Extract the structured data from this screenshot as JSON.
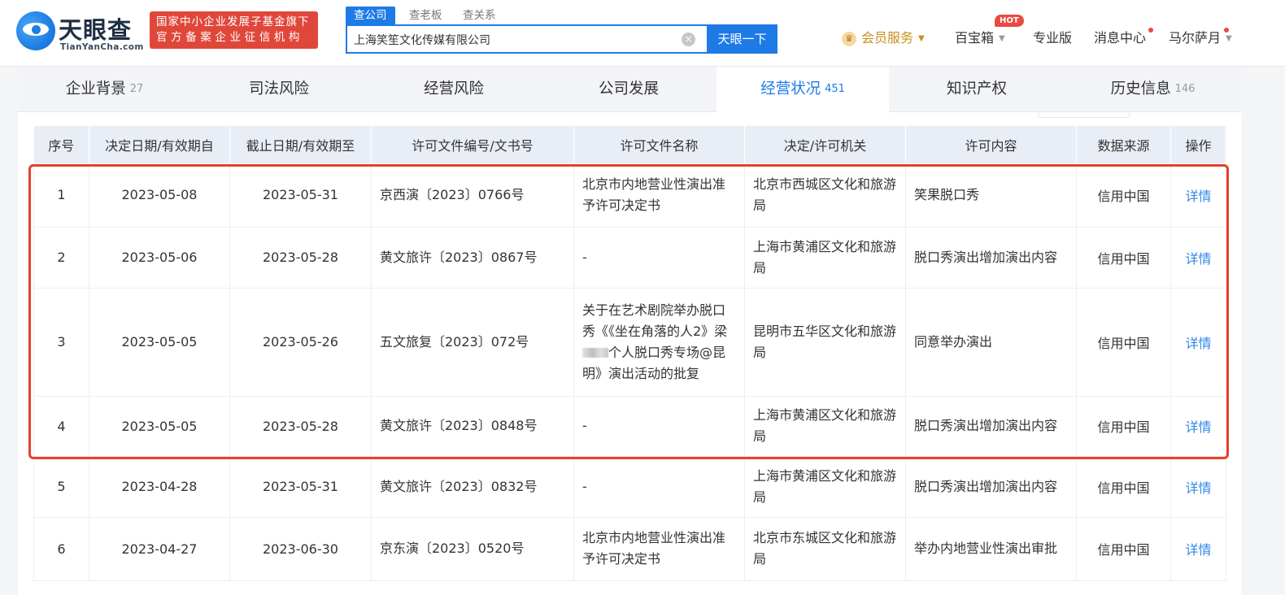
{
  "header": {
    "logo_text": "天眼查",
    "logo_sub": "TianYanCha.com",
    "slogan_line1": "国家中小企业发展子基金旗下",
    "slogan_line2": "官方备案企业征信机构",
    "search_tabs": [
      "查公司",
      "查老板",
      "查关系"
    ],
    "search_value": "上海笑笙文化传媒有限公司",
    "search_button": "天眼一下",
    "nav": {
      "vip": "会员服务",
      "baibao": "百宝箱",
      "hot_badge": "HOT",
      "pro": "专业版",
      "messages": "消息中心",
      "user": "马尔萨月"
    }
  },
  "tabs": [
    {
      "label": "企业背景",
      "count": "27"
    },
    {
      "label": "司法风险",
      "count": ""
    },
    {
      "label": "经营风险",
      "count": ""
    },
    {
      "label": "公司发展",
      "count": ""
    },
    {
      "label": "经营状况",
      "count": "451"
    },
    {
      "label": "知识产权",
      "count": ""
    },
    {
      "label": "历史信息",
      "count": "146"
    }
  ],
  "table": {
    "headers": [
      "序号",
      "决定日期/有效期自",
      "截止日期/有效期至",
      "许可文件编号/文书号",
      "许可文件名称",
      "决定/许可机关",
      "许可内容",
      "数据来源",
      "操作"
    ],
    "rows": [
      {
        "no": "1",
        "start": "2023-05-08",
        "end": "2023-05-31",
        "doc_no": "京西演〔2023〕0766号",
        "name": "北京市内地营业性演出准予许可决定书",
        "authority": "北京市西城区文化和旅游局",
        "content": "笑果脱口秀",
        "source": "信用中国",
        "action": "详情"
      },
      {
        "no": "2",
        "start": "2023-05-06",
        "end": "2023-05-28",
        "doc_no": "黄文旅许〔2023〕0867号",
        "name": "-",
        "authority": "上海市黄浦区文化和旅游局",
        "content": "脱口秀演出增加演出内容",
        "source": "信用中国",
        "action": "详情"
      },
      {
        "no": "3",
        "start": "2023-05-05",
        "end": "2023-05-26",
        "doc_no": "五文旅复〔2023〕072号",
        "name_part1": "关于在艺术剧院举办脱口秀《《坐在角落的人2》梁",
        "name_part2": "个人脱口秀专场@昆明》演出活动的批复",
        "authority": "昆明市五华区文化和旅游局",
        "content": "同意举办演出",
        "source": "信用中国",
        "action": "详情"
      },
      {
        "no": "4",
        "start": "2023-05-05",
        "end": "2023-05-28",
        "doc_no": "黄文旅许〔2023〕0848号",
        "name": "-",
        "authority": "上海市黄浦区文化和旅游局",
        "content": "脱口秀演出增加演出内容",
        "source": "信用中国",
        "action": "详情"
      },
      {
        "no": "5",
        "start": "2023-04-28",
        "end": "2023-05-31",
        "doc_no": "黄文旅许〔2023〕0832号",
        "name": "-",
        "authority": "上海市黄浦区文化和旅游局",
        "content": "脱口秀演出增加演出内容",
        "source": "信用中国",
        "action": "详情"
      },
      {
        "no": "6",
        "start": "2023-04-27",
        "end": "2023-06-30",
        "doc_no": "京东演〔2023〕0520号",
        "name": "北京市内地营业性演出准予许可决定书",
        "authority": "北京市东城区文化和旅游局",
        "content": "举办内地营业性演出审批",
        "source": "信用中国",
        "action": "详情"
      }
    ]
  },
  "colors": {
    "brand_blue": "#1e7be6",
    "slogan_red": "#e0473b",
    "highlight_red": "#e5402f",
    "vip_gold": "#c98f1d"
  }
}
